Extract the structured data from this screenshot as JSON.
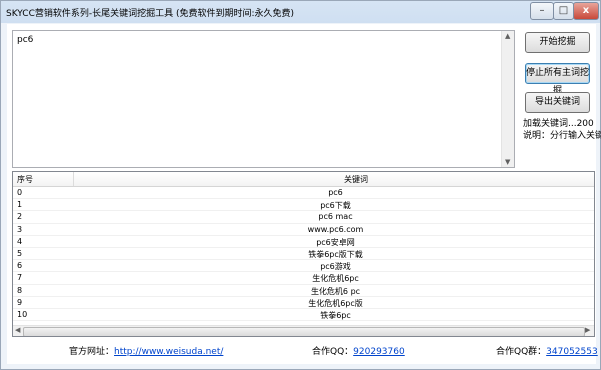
{
  "window": {
    "title": "SKYCC营销软件系列-长尾关键词挖掘工具 (免费软件到期时间:永久免费)",
    "buttons": {
      "minimize": "–",
      "maximize": "□",
      "close": "x"
    }
  },
  "input": {
    "value": "pc6"
  },
  "actions": {
    "start": "开始挖掘",
    "stop_all": "停止所有主词挖掘",
    "export": "导出关键词"
  },
  "info": {
    "loaded": "加载关键词...200",
    "hint": "说明：分行输入关键词"
  },
  "table": {
    "columns": [
      "序号",
      "关键词"
    ],
    "rows": [
      [
        "0",
        "pc6"
      ],
      [
        "1",
        "pc6下载"
      ],
      [
        "2",
        "pc6 mac"
      ],
      [
        "3",
        "www.pc6.com"
      ],
      [
        "4",
        "pc6安卓网"
      ],
      [
        "5",
        "铁拳6pc版下载"
      ],
      [
        "6",
        "pc6游戏"
      ],
      [
        "7",
        "生化危机6pc"
      ],
      [
        "8",
        "生化危机6 pc"
      ],
      [
        "9",
        "生化危机6pc版"
      ],
      [
        "10",
        "铁拳6pc"
      ]
    ]
  },
  "footer": {
    "site_label": "官方网址：",
    "site_url": "http://www.weisuda.net/",
    "qq_label": "合作QQ：",
    "qq": "920293760",
    "group_label": "合作QQ群：",
    "group": "347052553"
  },
  "colors": {
    "title_bar": "#d6e4f4",
    "link": "#0044cc",
    "focus": "#3c7fb1"
  }
}
